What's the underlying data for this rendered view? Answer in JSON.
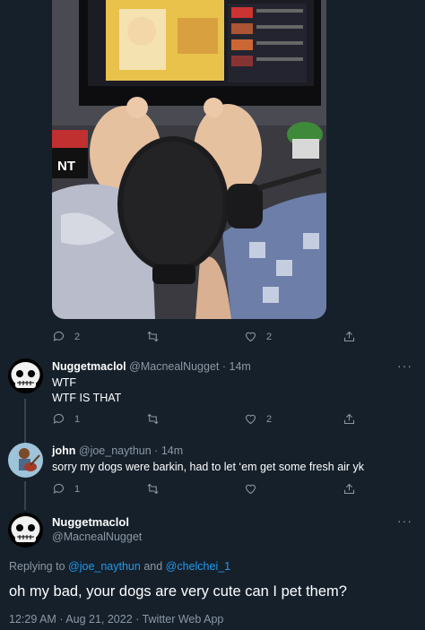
{
  "photo": {
    "alt_label": "NT"
  },
  "action_bars": [
    {
      "reply_count": "2",
      "retweet_count": "",
      "like_count": "2"
    },
    {
      "reply_count": "1",
      "retweet_count": "",
      "like_count": "2"
    },
    {
      "reply_count": "1",
      "retweet_count": "",
      "like_count": ""
    }
  ],
  "replies": [
    {
      "display_name": "Nuggetmaclol",
      "handle": "@MacnealNugget",
      "separator": "·",
      "time": "14m",
      "lines": [
        "WTF",
        "WTF IS THAT"
      ]
    },
    {
      "display_name": "john",
      "handle": "@joe_naythun",
      "separator": "·",
      "time": "14m",
      "lines": [
        "sorry my dogs were barkin, had to let ‘em get some fresh air yk"
      ]
    }
  ],
  "focused": {
    "display_name": "Nuggetmaclol",
    "handle": "@MacnealNugget",
    "replying_prefix": "Replying to",
    "mention_1": "@joe_naythun",
    "and_word": "and",
    "mention_2": "@chelchei_1",
    "text": "oh my bad, your dogs are very cute can I pet them?",
    "time": "12:29 AM",
    "date": "Aug 21, 2022",
    "separator": "·",
    "source": "Twitter Web App"
  },
  "icons": {
    "reply": "reply-icon",
    "retweet": "retweet-icon",
    "like": "heart-icon",
    "share": "share-icon",
    "more": "more-options-icon"
  },
  "colors": {
    "background": "#15202b",
    "secondary_text": "#8b98a5",
    "link": "#1d9bf0",
    "divider": "#38444d"
  }
}
